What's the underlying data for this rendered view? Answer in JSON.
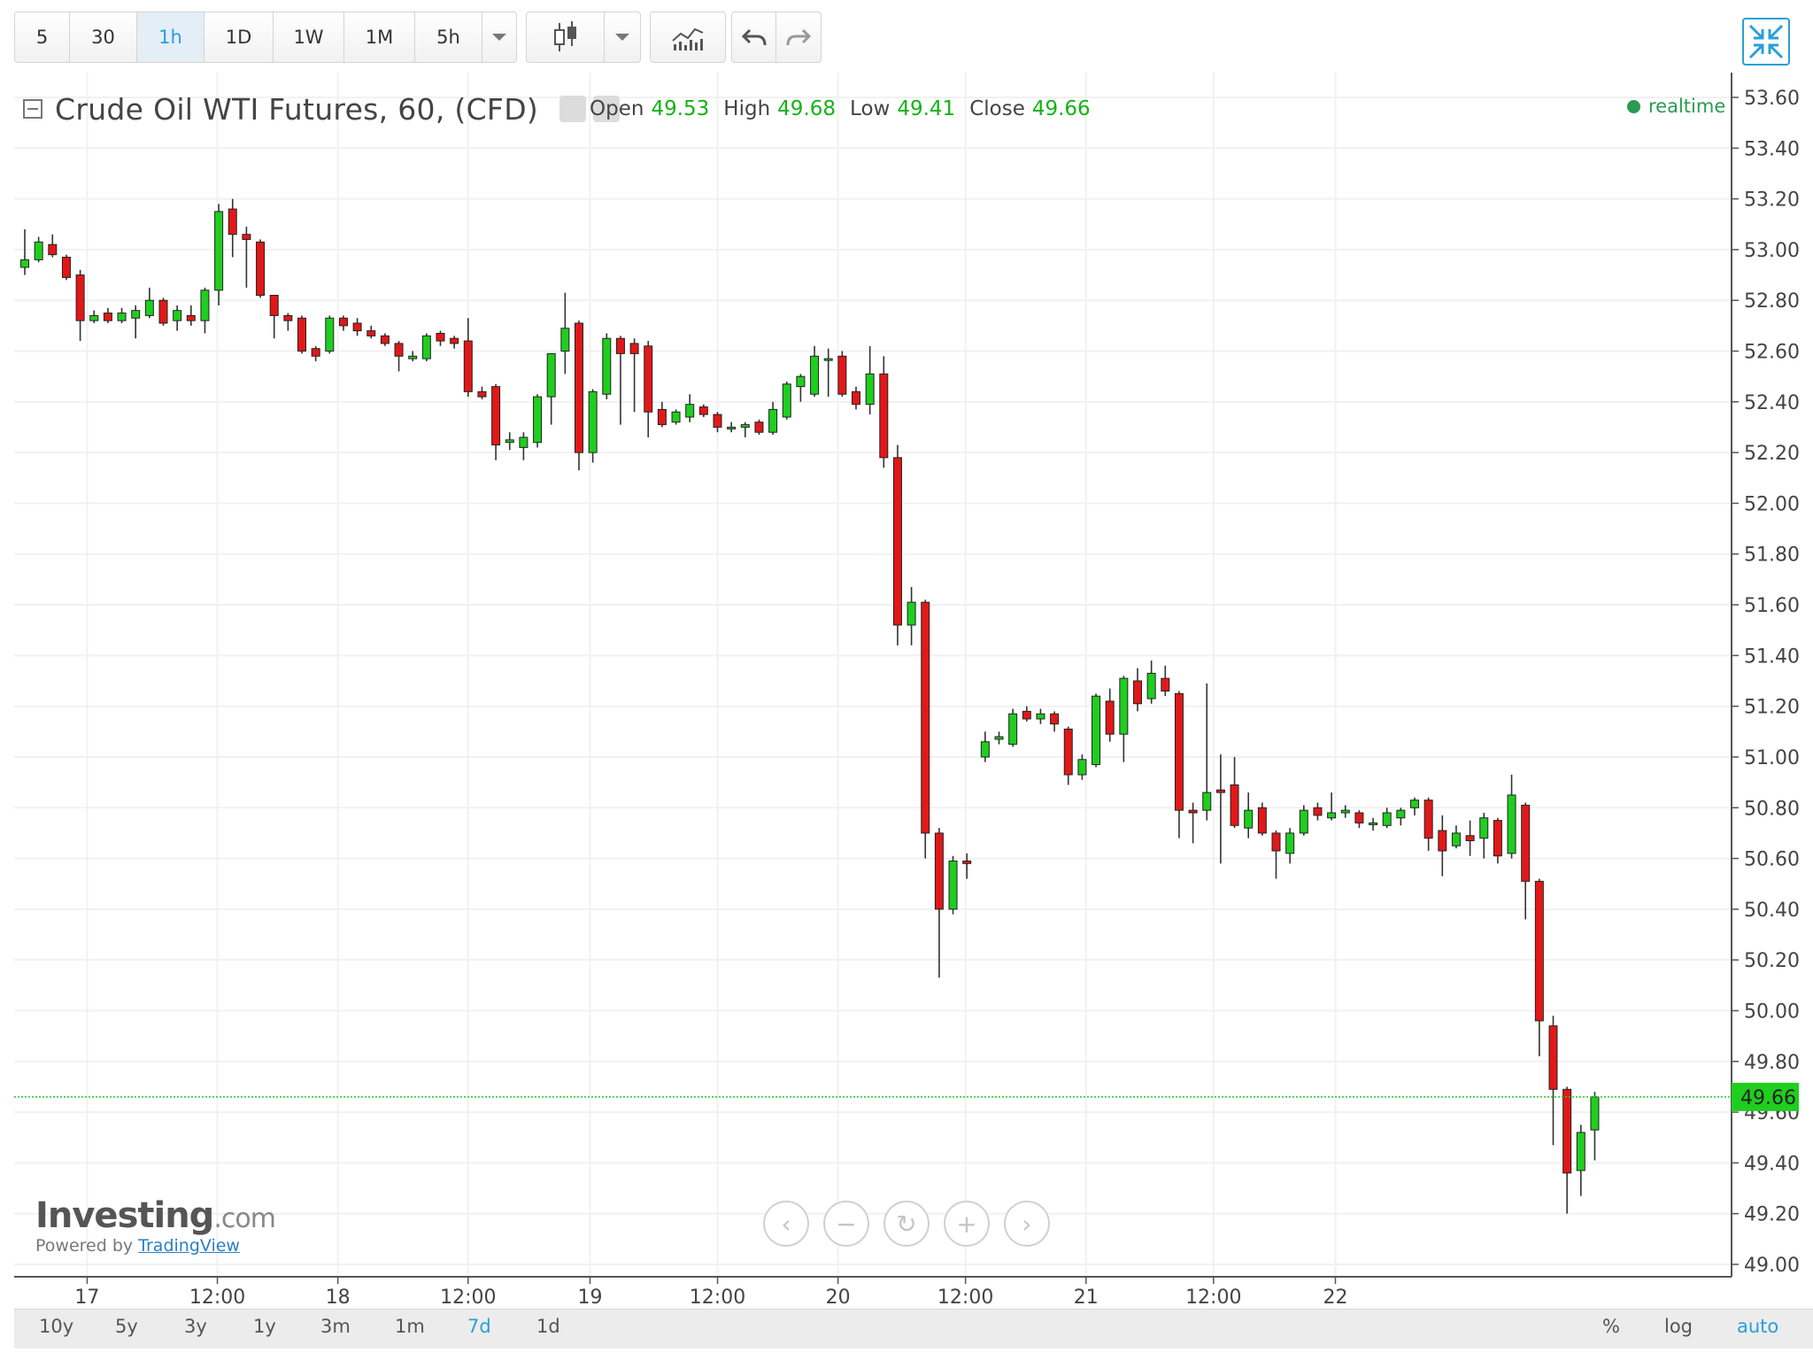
{
  "toolbar": {
    "intervals": [
      "5",
      "30",
      "1h",
      "1D",
      "1W",
      "1M",
      "5h"
    ],
    "active_interval": "1h"
  },
  "legend": {
    "title": "Crude Oil WTI Futures, 60, (CFD)",
    "open_label": "Open",
    "open": "49.53",
    "high_label": "High",
    "high": "49.68",
    "low_label": "Low",
    "low": "49.41",
    "close_label": "Close",
    "close": "49.66",
    "realtime": "realtime"
  },
  "ranges": [
    "10y",
    "5y",
    "3y",
    "1y",
    "3m",
    "1m",
    "7d",
    "1d"
  ],
  "active_range": "7d",
  "scale_options": [
    "%",
    "log",
    "auto"
  ],
  "brand": {
    "logo": "Investing",
    "logo_suffix": ".com",
    "powered": "Powered by",
    "powered_link": "TradingView"
  },
  "colors": {
    "up": "#1fce1f",
    "down": "#e21818",
    "last_price": "#1fce1f",
    "accent": "#2a9fd8"
  },
  "chart_data": {
    "type": "candlestick",
    "title": "Crude Oil WTI Futures, 60, (CFD)",
    "ylim": [
      49.0,
      53.6
    ],
    "y_ticks": [
      "53.60",
      "53.40",
      "53.20",
      "53.00",
      "52.80",
      "52.60",
      "52.40",
      "52.20",
      "52.00",
      "51.80",
      "51.60",
      "51.40",
      "51.20",
      "51.00",
      "50.80",
      "50.60",
      "50.40",
      "50.20",
      "50.00",
      "49.80",
      "49.60",
      "49.40",
      "49.20",
      "49.00"
    ],
    "x_ticks": [
      "17",
      "12:00",
      "18",
      "12:00",
      "19",
      "12:00",
      "20",
      "12:00",
      "21",
      "12:00",
      "22"
    ],
    "last_price": "49.66",
    "candles": [
      {
        "o": 52.93,
        "h": 53.08,
        "l": 52.9,
        "c": 52.96
      },
      {
        "o": 52.96,
        "h": 53.05,
        "l": 52.95,
        "c": 53.03
      },
      {
        "o": 53.02,
        "h": 53.06,
        "l": 52.97,
        "c": 52.98
      },
      {
        "o": 52.97,
        "h": 52.98,
        "l": 52.88,
        "c": 52.89
      },
      {
        "o": 52.9,
        "h": 52.92,
        "l": 52.64,
        "c": 52.72
      },
      {
        "o": 52.72,
        "h": 52.76,
        "l": 52.71,
        "c": 52.74
      },
      {
        "o": 52.75,
        "h": 52.77,
        "l": 52.71,
        "c": 52.72
      },
      {
        "o": 52.72,
        "h": 52.77,
        "l": 52.71,
        "c": 52.75
      },
      {
        "o": 52.73,
        "h": 52.78,
        "l": 52.65,
        "c": 52.76
      },
      {
        "o": 52.74,
        "h": 52.85,
        "l": 52.73,
        "c": 52.8
      },
      {
        "o": 52.8,
        "h": 52.81,
        "l": 52.7,
        "c": 52.71
      },
      {
        "o": 52.72,
        "h": 52.78,
        "l": 52.68,
        "c": 52.76
      },
      {
        "o": 52.74,
        "h": 52.78,
        "l": 52.7,
        "c": 52.72
      },
      {
        "o": 52.72,
        "h": 52.85,
        "l": 52.67,
        "c": 52.84
      },
      {
        "o": 52.84,
        "h": 53.18,
        "l": 52.78,
        "c": 53.15
      },
      {
        "o": 53.16,
        "h": 53.2,
        "l": 52.97,
        "c": 53.06
      },
      {
        "o": 53.06,
        "h": 53.09,
        "l": 52.85,
        "c": 53.04
      },
      {
        "o": 53.03,
        "h": 53.04,
        "l": 52.81,
        "c": 52.82
      },
      {
        "o": 52.82,
        "h": 52.82,
        "l": 52.65,
        "c": 52.74
      },
      {
        "o": 52.74,
        "h": 52.75,
        "l": 52.68,
        "c": 52.72
      },
      {
        "o": 52.73,
        "h": 52.74,
        "l": 52.59,
        "c": 52.6
      },
      {
        "o": 52.61,
        "h": 52.62,
        "l": 52.56,
        "c": 52.58
      },
      {
        "o": 52.6,
        "h": 52.74,
        "l": 52.59,
        "c": 52.73
      },
      {
        "o": 52.73,
        "h": 52.74,
        "l": 52.68,
        "c": 52.7
      },
      {
        "o": 52.71,
        "h": 52.73,
        "l": 52.66,
        "c": 52.68
      },
      {
        "o": 52.68,
        "h": 52.7,
        "l": 52.65,
        "c": 52.66
      },
      {
        "o": 52.66,
        "h": 52.67,
        "l": 52.62,
        "c": 52.63
      },
      {
        "o": 52.63,
        "h": 52.64,
        "l": 52.52,
        "c": 52.58
      },
      {
        "o": 52.57,
        "h": 52.6,
        "l": 52.56,
        "c": 52.58
      },
      {
        "o": 52.57,
        "h": 52.67,
        "l": 52.56,
        "c": 52.66
      },
      {
        "o": 52.67,
        "h": 52.68,
        "l": 52.62,
        "c": 52.64
      },
      {
        "o": 52.65,
        "h": 52.66,
        "l": 52.61,
        "c": 52.63
      },
      {
        "o": 52.64,
        "h": 52.73,
        "l": 52.42,
        "c": 52.44
      },
      {
        "o": 52.44,
        "h": 52.46,
        "l": 52.41,
        "c": 52.42
      },
      {
        "o": 52.46,
        "h": 52.47,
        "l": 52.17,
        "c": 52.23
      },
      {
        "o": 52.24,
        "h": 52.28,
        "l": 52.21,
        "c": 52.25
      },
      {
        "o": 52.22,
        "h": 52.28,
        "l": 52.17,
        "c": 52.26
      },
      {
        "o": 52.24,
        "h": 52.43,
        "l": 52.22,
        "c": 52.42
      },
      {
        "o": 52.42,
        "h": 52.59,
        "l": 52.31,
        "c": 52.59
      },
      {
        "o": 52.6,
        "h": 52.83,
        "l": 52.51,
        "c": 52.69
      },
      {
        "o": 52.71,
        "h": 52.72,
        "l": 52.13,
        "c": 52.2
      },
      {
        "o": 52.2,
        "h": 52.45,
        "l": 52.16,
        "c": 52.44
      },
      {
        "o": 52.43,
        "h": 52.67,
        "l": 52.41,
        "c": 52.65
      },
      {
        "o": 52.65,
        "h": 52.66,
        "l": 52.31,
        "c": 52.59
      },
      {
        "o": 52.63,
        "h": 52.65,
        "l": 52.36,
        "c": 52.59
      },
      {
        "o": 52.62,
        "h": 52.64,
        "l": 52.26,
        "c": 52.36
      },
      {
        "o": 52.37,
        "h": 52.4,
        "l": 52.3,
        "c": 52.31
      },
      {
        "o": 52.32,
        "h": 52.37,
        "l": 52.31,
        "c": 52.36
      },
      {
        "o": 52.34,
        "h": 52.43,
        "l": 52.32,
        "c": 52.39
      },
      {
        "o": 52.38,
        "h": 52.39,
        "l": 52.34,
        "c": 52.35
      },
      {
        "o": 52.35,
        "h": 52.36,
        "l": 52.28,
        "c": 52.3
      },
      {
        "o": 52.3,
        "h": 52.32,
        "l": 52.28,
        "c": 52.3
      },
      {
        "o": 52.3,
        "h": 52.32,
        "l": 52.26,
        "c": 52.31
      },
      {
        "o": 52.32,
        "h": 52.33,
        "l": 52.27,
        "c": 52.28
      },
      {
        "o": 52.28,
        "h": 52.4,
        "l": 52.27,
        "c": 52.37
      },
      {
        "o": 52.34,
        "h": 52.48,
        "l": 52.33,
        "c": 52.47
      },
      {
        "o": 52.46,
        "h": 52.51,
        "l": 52.4,
        "c": 52.5
      },
      {
        "o": 52.43,
        "h": 52.62,
        "l": 52.42,
        "c": 52.58
      },
      {
        "o": 52.57,
        "h": 52.61,
        "l": 52.42,
        "c": 52.57
      },
      {
        "o": 52.58,
        "h": 52.6,
        "l": 52.42,
        "c": 52.43
      },
      {
        "o": 52.44,
        "h": 52.46,
        "l": 52.37,
        "c": 52.39
      },
      {
        "o": 52.39,
        "h": 52.62,
        "l": 52.35,
        "c": 52.51
      },
      {
        "o": 52.51,
        "h": 52.58,
        "l": 52.14,
        "c": 52.18
      },
      {
        "o": 52.18,
        "h": 52.23,
        "l": 51.44,
        "c": 51.52
      },
      {
        "o": 51.52,
        "h": 51.67,
        "l": 51.44,
        "c": 51.61
      },
      {
        "o": 51.61,
        "h": 51.62,
        "l": 50.6,
        "c": 50.7
      },
      {
        "o": 50.7,
        "h": 50.72,
        "l": 50.13,
        "c": 50.4
      },
      {
        "o": 50.4,
        "h": 50.61,
        "l": 50.38,
        "c": 50.59
      },
      {
        "o": 50.59,
        "h": 50.62,
        "l": 50.52,
        "c": 50.58
      },
      {
        "o": 51.0,
        "h": 51.1,
        "l": 50.98,
        "c": 51.06
      },
      {
        "o": 51.07,
        "h": 51.1,
        "l": 51.05,
        "c": 51.08
      },
      {
        "o": 51.05,
        "h": 51.19,
        "l": 51.04,
        "c": 51.17
      },
      {
        "o": 51.18,
        "h": 51.2,
        "l": 51.14,
        "c": 51.15
      },
      {
        "o": 51.15,
        "h": 51.19,
        "l": 51.13,
        "c": 51.17
      },
      {
        "o": 51.17,
        "h": 51.18,
        "l": 51.1,
        "c": 51.13
      },
      {
        "o": 51.11,
        "h": 51.12,
        "l": 50.89,
        "c": 50.93
      },
      {
        "o": 50.93,
        "h": 51.01,
        "l": 50.91,
        "c": 50.99
      },
      {
        "o": 50.97,
        "h": 51.25,
        "l": 50.96,
        "c": 51.24
      },
      {
        "o": 51.22,
        "h": 51.27,
        "l": 51.06,
        "c": 51.09
      },
      {
        "o": 51.09,
        "h": 51.32,
        "l": 50.98,
        "c": 51.31
      },
      {
        "o": 51.3,
        "h": 51.35,
        "l": 51.18,
        "c": 51.21
      },
      {
        "o": 51.23,
        "h": 51.38,
        "l": 51.21,
        "c": 51.33
      },
      {
        "o": 51.31,
        "h": 51.36,
        "l": 51.24,
        "c": 51.26
      },
      {
        "o": 51.25,
        "h": 51.26,
        "l": 50.68,
        "c": 50.79
      },
      {
        "o": 50.79,
        "h": 50.82,
        "l": 50.66,
        "c": 50.78
      },
      {
        "o": 50.79,
        "h": 51.29,
        "l": 50.75,
        "c": 50.86
      },
      {
        "o": 50.87,
        "h": 51.01,
        "l": 50.58,
        "c": 50.86
      },
      {
        "o": 50.89,
        "h": 51.0,
        "l": 50.72,
        "c": 50.73
      },
      {
        "o": 50.72,
        "h": 50.86,
        "l": 50.68,
        "c": 50.79
      },
      {
        "o": 50.8,
        "h": 50.82,
        "l": 50.69,
        "c": 50.7
      },
      {
        "o": 50.7,
        "h": 50.71,
        "l": 50.52,
        "c": 50.63
      },
      {
        "o": 50.62,
        "h": 50.72,
        "l": 50.58,
        "c": 50.7
      },
      {
        "o": 50.7,
        "h": 50.81,
        "l": 50.69,
        "c": 50.79
      },
      {
        "o": 50.8,
        "h": 50.82,
        "l": 50.75,
        "c": 50.77
      },
      {
        "o": 50.76,
        "h": 50.86,
        "l": 50.75,
        "c": 50.78
      },
      {
        "o": 50.78,
        "h": 50.81,
        "l": 50.76,
        "c": 50.79
      },
      {
        "o": 50.78,
        "h": 50.79,
        "l": 50.72,
        "c": 50.74
      },
      {
        "o": 50.74,
        "h": 50.76,
        "l": 50.71,
        "c": 50.74
      },
      {
        "o": 50.73,
        "h": 50.8,
        "l": 50.72,
        "c": 50.78
      },
      {
        "o": 50.76,
        "h": 50.8,
        "l": 50.73,
        "c": 50.79
      },
      {
        "o": 50.8,
        "h": 50.84,
        "l": 50.77,
        "c": 50.83
      },
      {
        "o": 50.83,
        "h": 50.84,
        "l": 50.63,
        "c": 50.68
      },
      {
        "o": 50.71,
        "h": 50.77,
        "l": 50.53,
        "c": 50.63
      },
      {
        "o": 50.65,
        "h": 50.73,
        "l": 50.64,
        "c": 50.7
      },
      {
        "o": 50.69,
        "h": 50.75,
        "l": 50.61,
        "c": 50.67
      },
      {
        "o": 50.68,
        "h": 50.78,
        "l": 50.6,
        "c": 50.76
      },
      {
        "o": 50.75,
        "h": 50.76,
        "l": 50.58,
        "c": 50.61
      },
      {
        "o": 50.62,
        "h": 50.93,
        "l": 50.6,
        "c": 50.85
      },
      {
        "o": 50.81,
        "h": 50.82,
        "l": 50.36,
        "c": 50.51
      },
      {
        "o": 50.51,
        "h": 50.52,
        "l": 49.82,
        "c": 49.96
      },
      {
        "o": 49.94,
        "h": 49.98,
        "l": 49.47,
        "c": 49.69
      },
      {
        "o": 49.69,
        "h": 49.7,
        "l": 49.2,
        "c": 49.36
      },
      {
        "o": 49.37,
        "h": 49.55,
        "l": 49.27,
        "c": 49.52
      },
      {
        "o": 49.53,
        "h": 49.68,
        "l": 49.41,
        "c": 49.66
      }
    ]
  }
}
